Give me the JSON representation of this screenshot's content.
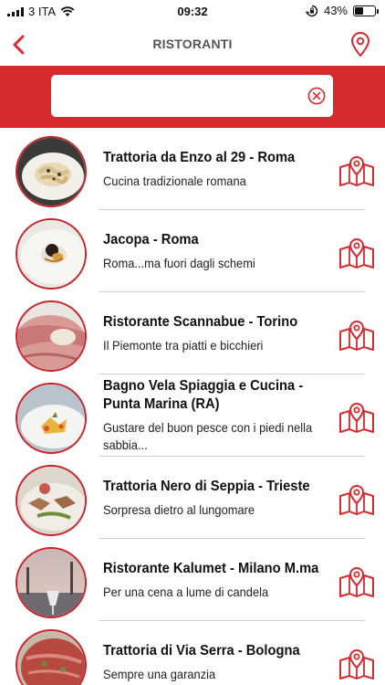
{
  "status_bar": {
    "carrier": "3 ITA",
    "time": "09:32",
    "battery": "43%",
    "battery_level": 0.43
  },
  "nav": {
    "title": "RISTORANTI"
  },
  "search": {
    "value": "",
    "placeholder": ""
  },
  "colors": {
    "accent": "#d52a2e",
    "text": "#111111"
  },
  "restaurants": [
    {
      "name": "Trattoria da Enzo al 29 - Roma",
      "description": "Cucina tradizionale romana"
    },
    {
      "name": "Jacopa - Roma",
      "description": "Roma...ma fuori dagli schemi"
    },
    {
      "name": "Ristorante Scannabue - Torino",
      "description": "Il Piemonte tra piatti e bicchieri"
    },
    {
      "name": "Bagno Vela Spiaggia e Cucina - Punta Marina (RA)",
      "description": "Gustare del buon pesce con i piedi nella sabbia..."
    },
    {
      "name": "Trattoria Nero di Seppia - Trieste",
      "description": "Sorpresa dietro al lungomare"
    },
    {
      "name": "Ristorante Kalumet - Milano M.ma",
      "description": "Per una cena a lume di candela"
    },
    {
      "name": "Trattoria di Via Serra - Bologna",
      "description": "Sempre una garanzia"
    }
  ]
}
